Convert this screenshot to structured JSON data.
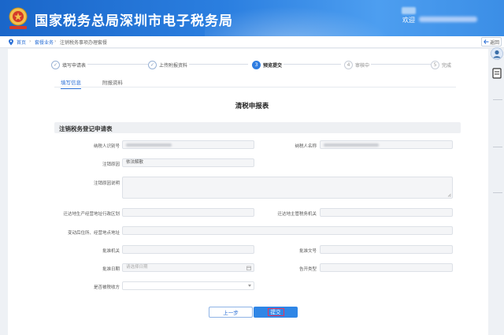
{
  "header": {
    "title": "国家税务总局深圳市电子税务局",
    "welcome": "欢迎"
  },
  "breadcrumb": {
    "items": [
      "首页",
      "套餐业务",
      "注销税务事项办理套餐"
    ],
    "back_label": "返回"
  },
  "steps": [
    {
      "num": "1",
      "label": "填写申请表",
      "state": "done"
    },
    {
      "num": "2",
      "label": "上传附报资料",
      "state": "done"
    },
    {
      "num": "3",
      "label": "预览提交",
      "state": "active"
    },
    {
      "num": "4",
      "label": "审核中",
      "state": "future"
    },
    {
      "num": "5",
      "label": "完成",
      "state": "future"
    }
  ],
  "tabs": [
    {
      "label": "填写信息",
      "active": true
    },
    {
      "label": "附报资料",
      "active": false
    }
  ],
  "form": {
    "title": "清税申报表",
    "section_title": "注销税务登记申请表",
    "fields": {
      "taxpayer_id": {
        "label": "纳税人识别号"
      },
      "taxpayer_name": {
        "label": "纳税人名称"
      },
      "cancel_reason": {
        "label": "注销原因",
        "value": "依法解散"
      },
      "cancel_reason_desc": {
        "label": "注销原因说明"
      },
      "region": {
        "label": "迁达地生产经营地址行政区划"
      },
      "tax_authority": {
        "label": "迁达地主管税务机关"
      },
      "address": {
        "label": "变动后住所、经营地点地址"
      },
      "approve_org": {
        "label": "批准机关"
      },
      "approve_doc": {
        "label": "批准文号"
      },
      "approve_date": {
        "label": "批准日期",
        "placeholder": "请选择日期"
      },
      "doc_type": {
        "label": "告开类型"
      },
      "is_collector": {
        "label": "是否被税收方"
      }
    }
  },
  "buttons": {
    "prev": "上一步",
    "submit": "提交"
  },
  "colors": {
    "header_blue": "#2b7fe0",
    "accent": "#2f86e6",
    "highlight": "#e8325a"
  }
}
